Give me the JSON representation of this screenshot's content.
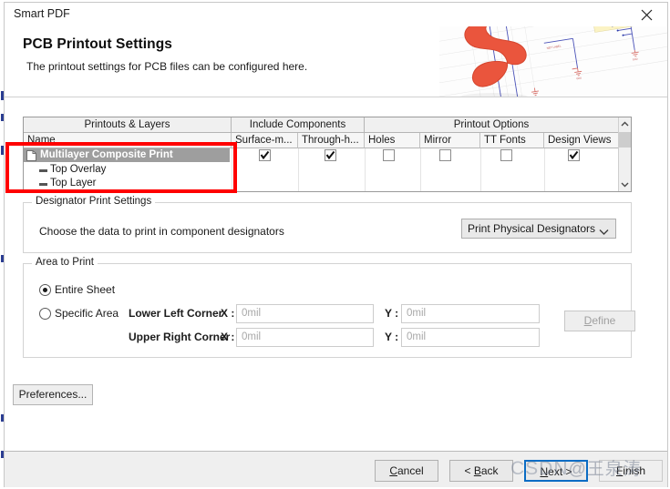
{
  "window": {
    "title": "Smart PDF",
    "close_icon": "close-icon"
  },
  "banner": {
    "heading": "PCB Printout Settings",
    "subheading": "The printout settings for PCB files can be configured here.",
    "artwork": "adobe-pdf-logo-schematic"
  },
  "grid": {
    "group_headers": [
      {
        "label": "Printouts & Layers"
      },
      {
        "label": "Include Components"
      },
      {
        "label": "Printout Options"
      }
    ],
    "columns": [
      {
        "label": "Name"
      },
      {
        "label": "Surface-m..."
      },
      {
        "label": "Through-h..."
      },
      {
        "label": "Holes"
      },
      {
        "label": "Mirror"
      },
      {
        "label": "TT Fonts"
      },
      {
        "label": "Design Views"
      }
    ],
    "rows": [
      {
        "name": "Multilayer Composite Print",
        "icon": "document-icon",
        "level": 0,
        "selected": true,
        "checks": [
          true,
          true,
          false,
          false,
          false,
          true
        ]
      },
      {
        "name": "Top Overlay",
        "icon": "layer-dash-icon",
        "level": 1,
        "selected": false,
        "checks": []
      },
      {
        "name": "Top Layer",
        "icon": "layer-dash-icon",
        "level": 1,
        "selected": false,
        "checks": []
      }
    ],
    "scrollbar": {
      "up_icon": "chevron-up-icon",
      "down_icon": "chevron-down-icon"
    }
  },
  "designator": {
    "legend": "Designator Print Settings",
    "label": "Choose the data to print in component designators",
    "select_value": "Print Physical Designators",
    "select_icon": "chevron-down-icon"
  },
  "area_to_print": {
    "legend": "Area to Print",
    "options": [
      {
        "label": "Entire Sheet",
        "selected": true
      },
      {
        "label": "Specific Area",
        "selected": false
      }
    ],
    "lower_left_label": "Lower Left Corner",
    "upper_right_label": "Upper Right Corner",
    "x_label": "X :",
    "y_label": "Y :",
    "lower_left_x_placeholder": "0mil",
    "lower_left_y_placeholder": "0mil",
    "upper_right_x_placeholder": "0mil",
    "upper_right_y_placeholder": "0mil",
    "lower_left_x_value": "",
    "lower_left_y_value": "",
    "upper_right_x_value": "",
    "upper_right_y_value": "",
    "define_button": "Define",
    "define_enabled": false
  },
  "preferences_button": "Preferences...",
  "footer": {
    "cancel": "Cancel",
    "back": "< Back",
    "next": "Next >",
    "finish": "Finish"
  },
  "annotation": {
    "highlight_color": "#ff0000",
    "shape": "rectangle"
  },
  "watermark": {
    "text_latin": "CSDN",
    "text_cjk": "@王泉涛"
  }
}
